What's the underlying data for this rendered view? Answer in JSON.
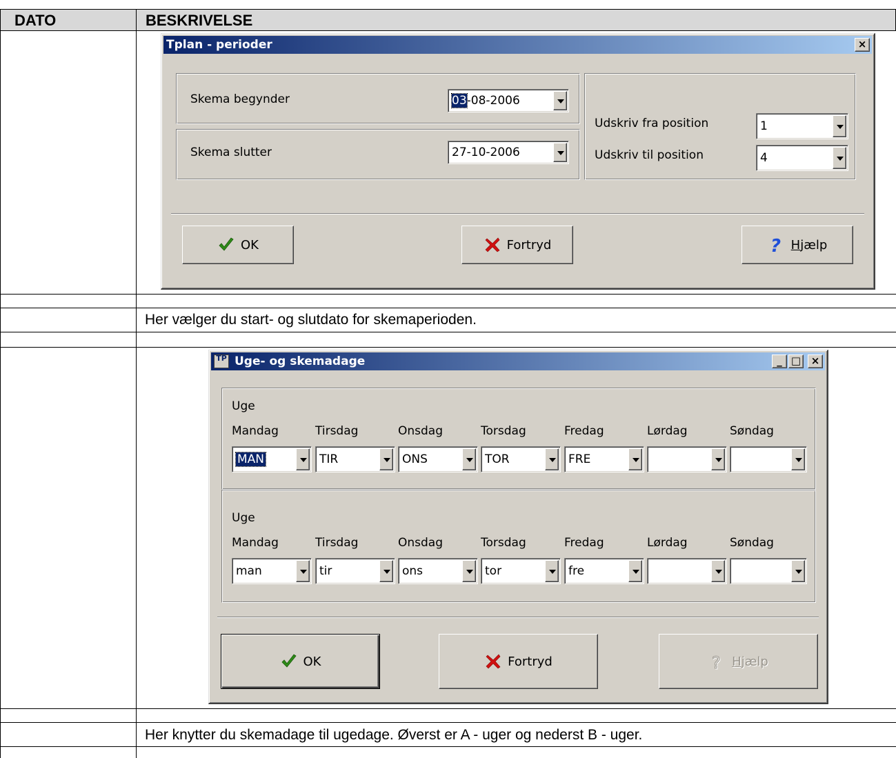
{
  "table": {
    "header_col1": "DATO",
    "header_col2": "BESKRIVELSE",
    "desc1": "Her vælger du start- og slutdato for skemaperioden.",
    "desc2": "Her knytter du skemadage til ugedage. Øverst er A - uger og nederst B - uger."
  },
  "dialog1": {
    "title": "Tplan - perioder",
    "close_symbol": "×",
    "start_label": "Skema begynder",
    "start_day": "03",
    "start_rest": "-08-2006",
    "end_label": "Skema slutter",
    "end_value": "27-10-2006",
    "from_label": "Udskriv fra position",
    "from_value": "1",
    "to_label": "Udskriv til position",
    "to_value": "4",
    "ok_label": "OK",
    "cancel_label": "Fortryd",
    "help_hotkey": "H",
    "help_rest": "jælp"
  },
  "dialog2": {
    "title": "Uge- og skemadage",
    "icon_text": "TP",
    "minimize_symbol": "_",
    "maximize_symbol": "□",
    "close_symbol": "×",
    "week_label": "Uge",
    "days": [
      "Mandag",
      "Tirsdag",
      "Onsdag",
      "Torsdag",
      "Fredag",
      "Lørdag",
      "Søndag"
    ],
    "week_a_values": [
      "MAN",
      "TIR",
      "ONS",
      "TOR",
      "FRE",
      "",
      ""
    ],
    "week_b_values": [
      "man",
      "tir",
      "ons",
      "tor",
      "fre",
      "",
      ""
    ],
    "ok_label": "OK",
    "cancel_label": "Fortryd",
    "help_hotkey": "H",
    "help_rest": "jælp"
  },
  "colors": {
    "title_start": "#0a246a",
    "title_end": "#a6caf0",
    "window_face": "#d4d0c8",
    "check_green": "#2e8b18",
    "cross_red": "#d01010",
    "help_blue": "#1f4fd8"
  }
}
